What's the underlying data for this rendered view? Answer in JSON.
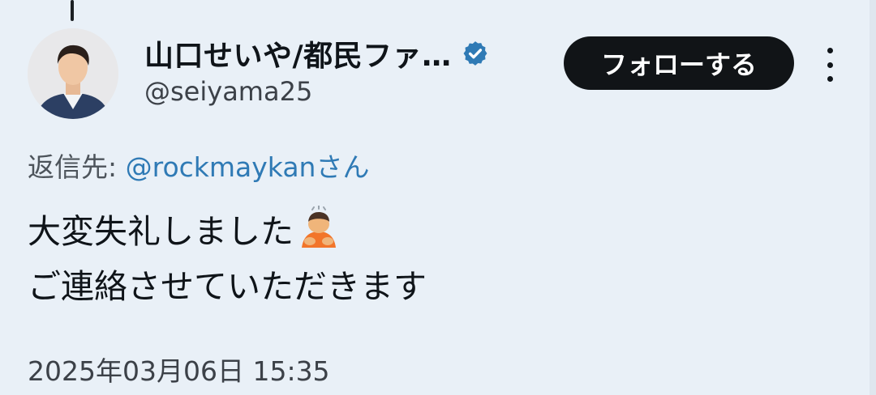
{
  "author": {
    "display_name": "山口せいや/都民ファ…",
    "handle": "@seiyama25",
    "verified": true
  },
  "follow_button": {
    "label": "フォローする"
  },
  "more_menu": {
    "icon": "more-vertical-icon"
  },
  "reply": {
    "prefix": "返信先: ",
    "mention": "@rockmaykan",
    "suffix": "さん"
  },
  "tweet": {
    "line1": "大変失礼しました",
    "line1_emoji": "person-bowing-emoji",
    "line2": "ご連絡させていただきます"
  },
  "timestamp": "2025年03月06日 15:35",
  "colors": {
    "background": "#e9f0f7",
    "accent": "#2f7ab5",
    "button": "#111417"
  }
}
